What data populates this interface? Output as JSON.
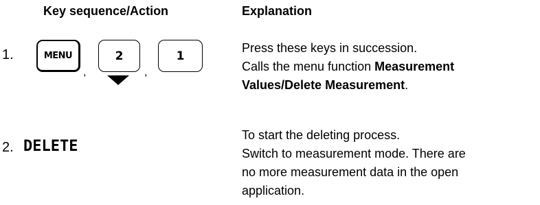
{
  "headers": {
    "key_sequence": "Key sequence/Action",
    "explanation": "Explanation"
  },
  "steps": [
    {
      "number": "1.",
      "keys": [
        "MENU",
        "2",
        "1"
      ],
      "separator": ",",
      "explanation_line1": "Press these keys in succession.",
      "explanation_line2_prefix": "Calls the menu function ",
      "explanation_line2_bold": "Measurement",
      "explanation_line3_bold": "Values/Delete Measurement",
      "explanation_line3_suffix": "."
    },
    {
      "number": "2.",
      "softkey": "DELETE",
      "explanation_lines": [
        "To start the deleting process.",
        "Switch to measurement mode. There are",
        "no more measurement data in the open",
        "application."
      ]
    }
  ],
  "icons": {
    "selected_key_indicator": "down-triangle-icon"
  }
}
